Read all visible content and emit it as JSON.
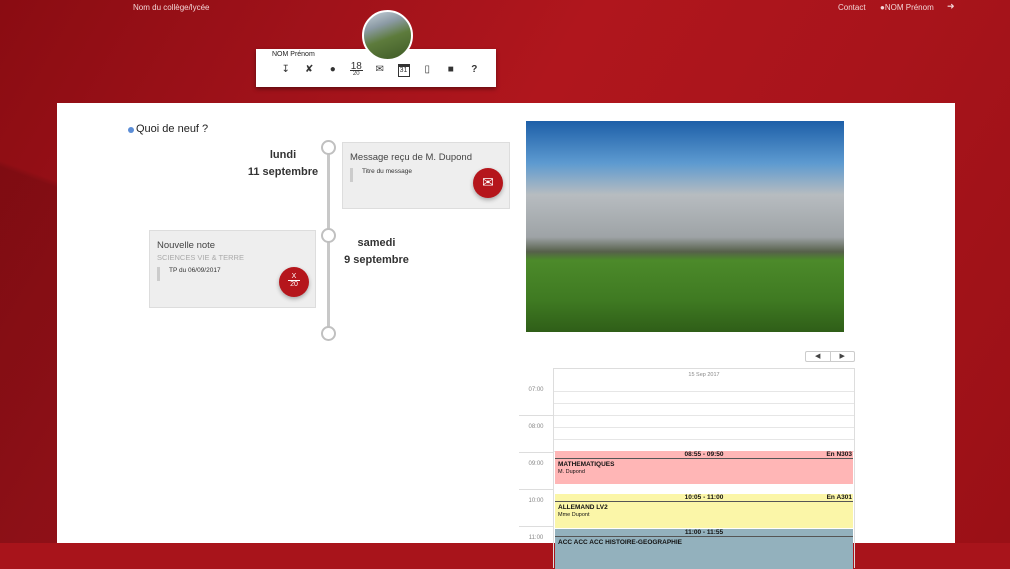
{
  "header": {
    "school": "Nom du collège/lycée",
    "contact": "Contact",
    "user": "NOM Prénom",
    "logout_icon": "logout-icon"
  },
  "profile": {
    "name": "NOM Prénom",
    "icons": [
      "timeline-icon",
      "tools-icon",
      "chat-icon",
      "grades-icon",
      "mail-icon",
      "calendar-icon",
      "notebook-icon",
      "folder-icon",
      "help-icon"
    ],
    "grades_top": "18",
    "grades_bottom": "20",
    "calendar_day": "31"
  },
  "news": {
    "title": "Quoi de neuf ?",
    "items": [
      {
        "day": "lundi",
        "date": "11 septembre",
        "title": "Message reçu de M. Dupond",
        "quote": "Titre du message",
        "icon": "mail-icon"
      },
      {
        "day": "samedi",
        "date": "9 septembre",
        "title": "Nouvelle note",
        "subject": "SCIENCES VIE & TERRE",
        "quote": "TP du 06/09/2017",
        "grade_top": "X",
        "grade_bottom": "20"
      }
    ]
  },
  "calendar": {
    "date": "15 Sep 2017",
    "prev": "◀",
    "next": "▶",
    "hours": [
      "07:00",
      "08:00",
      "09:00",
      "10:00",
      "11:00"
    ],
    "events": [
      {
        "time": "08:55 - 09:50",
        "room": "En N303",
        "subject": "MATHEMATIQUES",
        "teacher": "M. Dupond",
        "color": "#ffb6b6"
      },
      {
        "time": "10:05 - 11:00",
        "room": "En A301",
        "subject": "ALLEMAND LV2",
        "teacher": "Mme Dupont",
        "color": "#fbf6a8"
      },
      {
        "time": "11:00 - 11:55",
        "room": "",
        "subject": "ACC ACC ACC HISTOIRE-GEOGRAPHIE",
        "teacher": "",
        "color": "#93b1bd"
      }
    ]
  }
}
